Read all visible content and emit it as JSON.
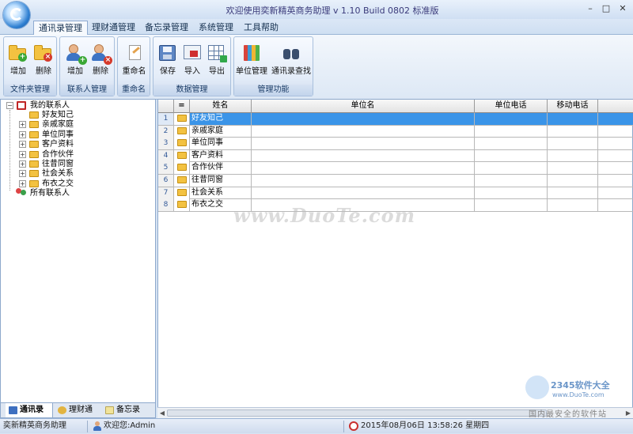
{
  "window": {
    "title": "欢迎使用奕新精英商务助理  v 1.10 Build 0802  标准版",
    "controls": [
      "–",
      "□",
      "✕"
    ]
  },
  "tabs": [
    "通讯录管理",
    "理财通管理",
    "备忘录管理",
    "系统管理",
    "工具帮助"
  ],
  "ribbon": {
    "groups": [
      {
        "label": "文件夹管理",
        "buttons": [
          {
            "label": "增加",
            "icon": "folder-add-icon"
          },
          {
            "label": "删除",
            "icon": "folder-delete-icon"
          }
        ]
      },
      {
        "label": "联系人管理",
        "buttons": [
          {
            "label": "增加",
            "icon": "contact-add-icon"
          },
          {
            "label": "删除",
            "icon": "contact-delete-icon"
          }
        ]
      },
      {
        "label": "重命名",
        "buttons": [
          {
            "label": "重命名",
            "icon": "rename-icon"
          }
        ]
      },
      {
        "label": "数据管理",
        "buttons": [
          {
            "label": "保存",
            "icon": "save-icon"
          },
          {
            "label": "导入",
            "icon": "import-icon"
          },
          {
            "label": "导出",
            "icon": "export-icon"
          }
        ]
      },
      {
        "label": "管理功能",
        "buttons": [
          {
            "label": "单位管理",
            "icon": "unit-manage-icon"
          },
          {
            "label": "通讯录查找",
            "icon": "binoculars-icon"
          }
        ]
      }
    ]
  },
  "tree": {
    "root": "我的联系人",
    "children": [
      "好友知己",
      "亲戚家庭",
      "单位同事",
      "客户资料",
      "合作伙伴",
      "往昔同窗",
      "社会关系",
      "布衣之交"
    ],
    "all_contacts": "所有联系人"
  },
  "left_tabs": [
    "通讯录",
    "理财通",
    "备忘录"
  ],
  "grid": {
    "headers": [
      "",
      "=",
      "姓名",
      "单位名",
      "单位电话",
      "移动电话"
    ],
    "rows": [
      {
        "num": "1",
        "name": "好友知己"
      },
      {
        "num": "2",
        "name": "亲戚家庭"
      },
      {
        "num": "3",
        "name": "单位同事"
      },
      {
        "num": "4",
        "name": "客户资料"
      },
      {
        "num": "5",
        "name": "合作伙伴"
      },
      {
        "num": "6",
        "name": "往昔同窗"
      },
      {
        "num": "7",
        "name": "社会关系"
      },
      {
        "num": "8",
        "name": "布衣之交"
      }
    ],
    "selected_row": 0
  },
  "watermarks": {
    "center": "www.DuoTe.com",
    "corner_brand": "2345软件大全",
    "corner_url": "www.DuoTe.com",
    "corner_slogan": "国内最安全的软件站"
  },
  "status": {
    "app_name": "奕新精英商务助理",
    "welcome": "欢迎您:Admin",
    "datetime": "2015年08月06日  13:58:26  星期四"
  },
  "colors": {
    "accent": "#3a94e8",
    "frame": "#d6e3f3"
  }
}
